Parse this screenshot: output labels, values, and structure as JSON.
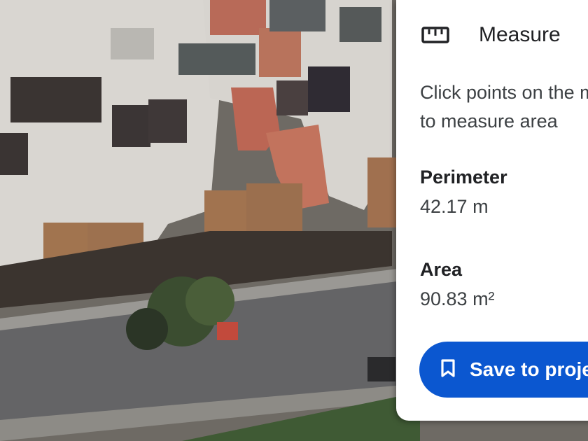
{
  "map": {
    "view": "satellite"
  },
  "panel": {
    "title": "Measure",
    "icon": "ruler-icon",
    "instructions": "Click points on the map to measure area",
    "perimeter_label": "Perimeter",
    "perimeter_value": "42.17 m",
    "area_label": "Area",
    "area_value": "90.83 m²",
    "save_label": "Save to project",
    "save_icon": "bookmark-icon"
  },
  "colors": {
    "accent": "#0b57d0",
    "panel_bg": "#ffffff"
  }
}
